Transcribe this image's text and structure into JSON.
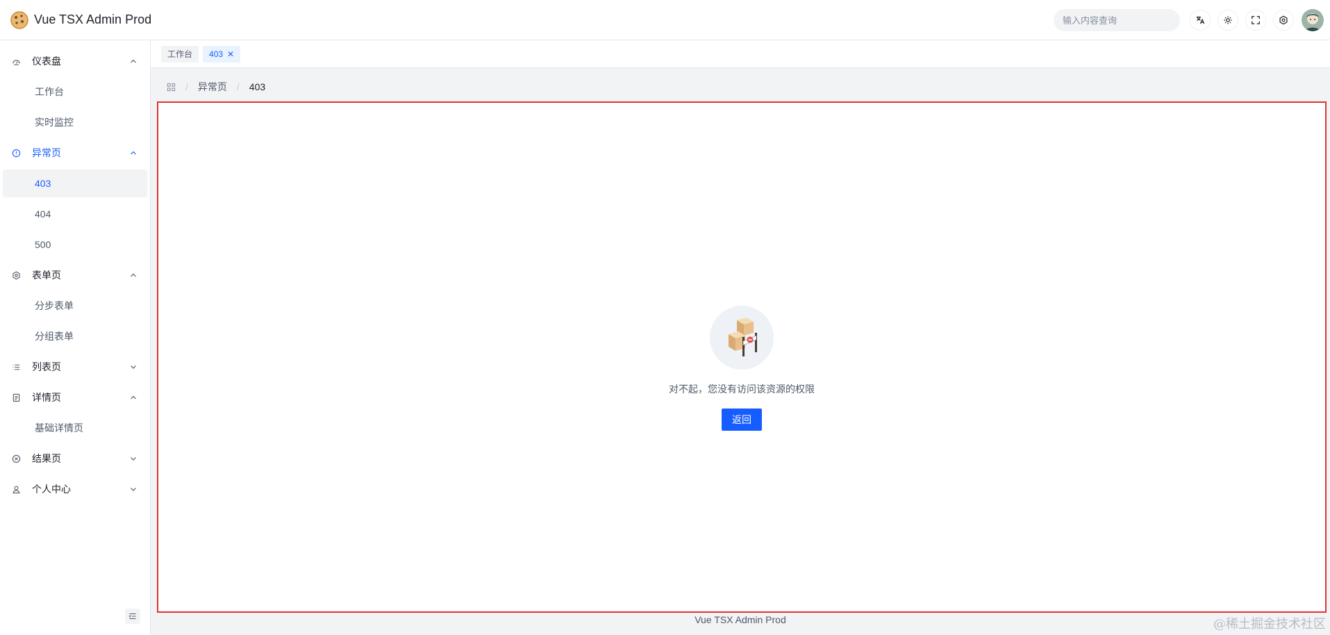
{
  "app": {
    "title": "Vue TSX Admin Prod"
  },
  "header": {
    "search_placeholder": "输入内容查询",
    "icons": [
      "translate-icon",
      "theme-icon",
      "fullscreen-icon",
      "settings-icon"
    ]
  },
  "sidebar": {
    "items": [
      {
        "label": "仪表盘",
        "icon": "dashboard-icon",
        "expanded": true
      },
      {
        "label": "工作台"
      },
      {
        "label": "实时监控"
      },
      {
        "label": "异常页",
        "icon": "exclamation-icon",
        "expanded": true
      },
      {
        "label": "403"
      },
      {
        "label": "404"
      },
      {
        "label": "500"
      },
      {
        "label": "表单页",
        "icon": "gear-icon",
        "expanded": true
      },
      {
        "label": "分步表单"
      },
      {
        "label": "分组表单"
      },
      {
        "label": "列表页",
        "icon": "list-icon",
        "expanded": false
      },
      {
        "label": "详情页",
        "icon": "file-icon",
        "expanded": true
      },
      {
        "label": "基础详情页"
      },
      {
        "label": "结果页",
        "icon": "close-circle-icon",
        "expanded": false
      },
      {
        "label": "个人中心",
        "icon": "user-icon",
        "expanded": false
      }
    ]
  },
  "tabs": [
    {
      "label": "工作台"
    },
    {
      "label": "403",
      "close": "✕"
    }
  ],
  "breadcrumb": {
    "sep": "/",
    "items": [
      "异常页",
      "403"
    ]
  },
  "result": {
    "message": "对不起，您没有访问该资源的权限",
    "button": "返回"
  },
  "footer": {
    "text": "Vue TSX Admin Prod"
  },
  "watermark": "@稀土掘金技术社区",
  "colors": {
    "primary": "#165dff",
    "highlight_border": "#e03131"
  }
}
